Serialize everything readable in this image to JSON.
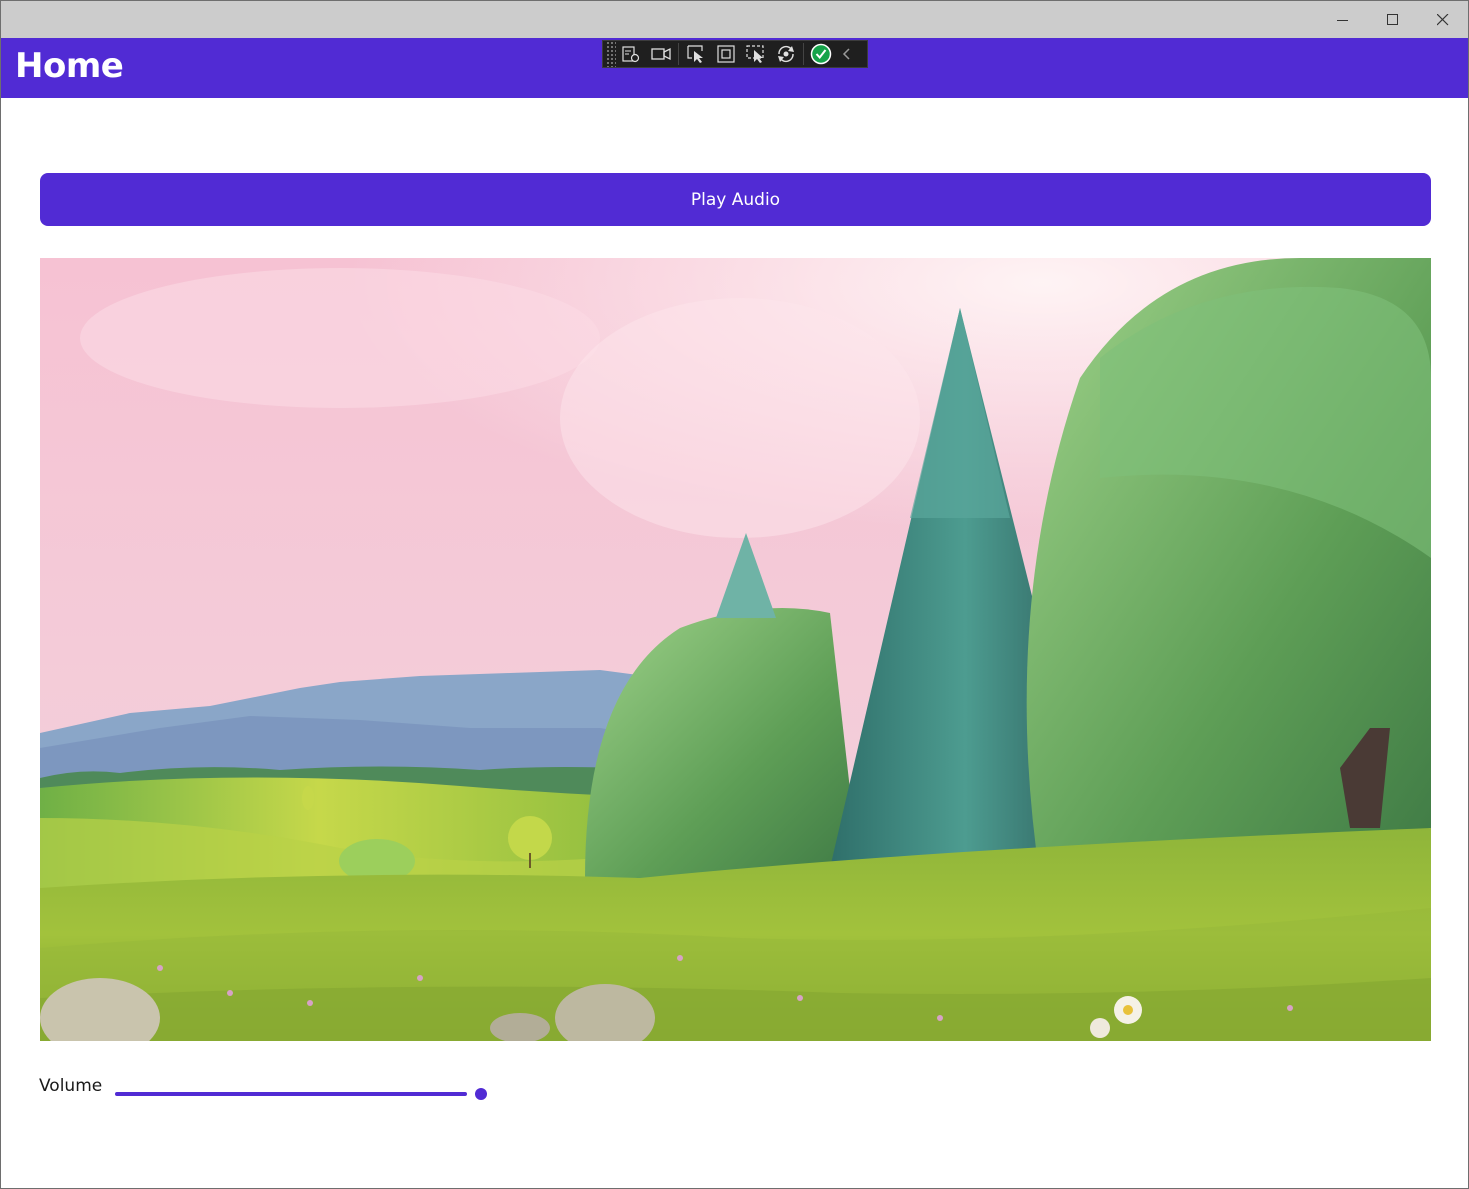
{
  "window": {
    "controls": [
      "minimize-icon",
      "maximize-icon",
      "close-icon"
    ]
  },
  "header": {
    "title": "Home",
    "background": "#512bd4"
  },
  "debug_toolbar": {
    "icons": [
      "live-visual-tree-icon",
      "record-icon",
      "select-element-icon",
      "display-layout-adorners-icon",
      "track-focused-element-icon",
      "hot-reload-icon",
      "binding-status-ok-icon",
      "collapse-chevron-icon"
    ]
  },
  "main": {
    "play_button_label": "Play Audio",
    "media_alt": "Animated meadow scene with trees",
    "volume": {
      "label": "Volume",
      "value": 1.0
    }
  },
  "colors": {
    "accent": "#512bd4",
    "titlebar": "#cccccc"
  }
}
